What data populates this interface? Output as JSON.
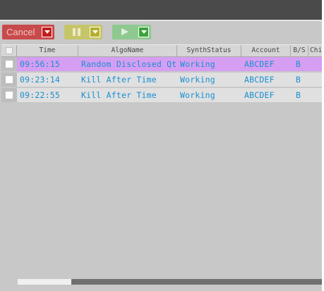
{
  "window": {
    "title": ""
  },
  "toolbar": {
    "cancel_label": "Cancel",
    "cancel_icon": "chevron-down-icon",
    "pause_icon": "pause-icon",
    "play_icon": "play-icon",
    "colors": {
      "cancel": "#c84a4a",
      "pause": "#c6c56a",
      "play": "#8fc98f"
    }
  },
  "grid": {
    "columns": [
      "",
      "Time",
      "AlgoName",
      "SynthStatus",
      "Account",
      "B/S",
      "Chi"
    ],
    "rows": [
      {
        "time": "09:56:15",
        "algo": "Random Disclosed Qty",
        "status": "Working",
        "account": "ABCDEF",
        "side": "B",
        "selected": true
      },
      {
        "time": "09:23:14",
        "algo": "Kill After Time",
        "status": "Working",
        "account": "ABCDEF",
        "side": "B",
        "selected": false
      },
      {
        "time": "09:22:55",
        "algo": "Kill After Time",
        "status": "Working",
        "account": "ABCDEF",
        "side": "B",
        "selected": false
      }
    ],
    "colors": {
      "text": "#1a8fd0",
      "selected_row": "#d69ef2",
      "row": "#e0e0e0"
    }
  }
}
